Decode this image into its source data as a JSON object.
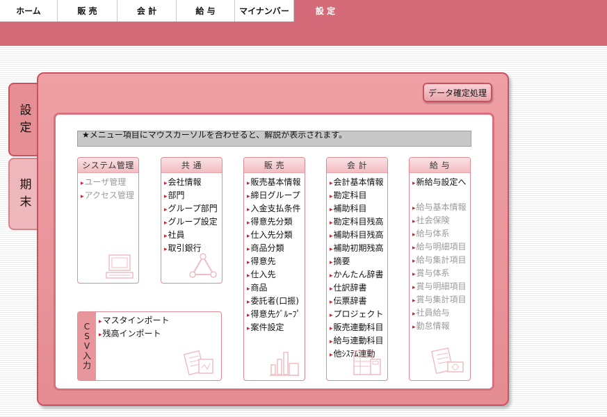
{
  "nav": {
    "tabs": [
      {
        "label": "ホーム"
      },
      {
        "label": "販 売"
      },
      {
        "label": "会 計"
      },
      {
        "label": "給 与"
      },
      {
        "label": "マイナンバー"
      },
      {
        "label": "設 定"
      }
    ],
    "active_tab": "設 定"
  },
  "side_tabs": [
    {
      "label": "設定",
      "chars": [
        "設",
        "定"
      ],
      "active": true
    },
    {
      "label": "期末",
      "chars": [
        "期",
        "末"
      ],
      "active": false
    }
  ],
  "confirm_button": "データ確定処理",
  "hint": "★メニュー項目にマウスカーソルを合わせると、解説が表示されます。",
  "categories": {
    "system": {
      "title": "システム管理",
      "items": [
        "ユーザ管理",
        "アクセス管理"
      ]
    },
    "common": {
      "title": "共 通",
      "items": [
        "会社情報",
        "部門",
        "グループ部門",
        "グループ設定",
        "社員",
        "取引銀行"
      ]
    },
    "sales": {
      "title": "販 売",
      "items": [
        "販売基本情報",
        "締日グループ",
        "入金支払条件",
        "得意先分類",
        "仕入先分類",
        "商品分類",
        "得意先",
        "仕入先",
        "商品",
        "委託者(口振)",
        "得意先ｸﾞﾙｰﾌﾟ",
        "案件設定"
      ]
    },
    "accounting": {
      "title": "会 計",
      "items": [
        "会計基本情報",
        "勘定科目",
        "補助科目",
        "勘定科目残高",
        "補助科目残高",
        "補助初期残高",
        "摘要",
        "かんたん辞書",
        "仕訳辞書",
        "伝票辞書",
        "プロジェクト",
        "販売連動科目",
        "給与連動科目",
        "他ｼｽﾃﾑ連動"
      ]
    },
    "payroll": {
      "title": "給 与",
      "items": [
        "新給与設定へ",
        "給与基本情報",
        "社会保険",
        "給与体系",
        "給与明細項目",
        "給与集計項目",
        "賞与体系",
        "賞与明細項目",
        "賞与集計項目",
        "社員給与",
        "勤怠情報"
      ]
    }
  },
  "csv": {
    "label": "CSV入力",
    "label_chars": [
      "C",
      "S",
      "V",
      "入",
      "力"
    ],
    "items": [
      "マスタインポート",
      "残高インポート"
    ]
  },
  "colors": {
    "brand": "#d56b78",
    "panel": "#e48d93",
    "accent_red": "#cc2233",
    "disabled": "#9a9a9a"
  }
}
